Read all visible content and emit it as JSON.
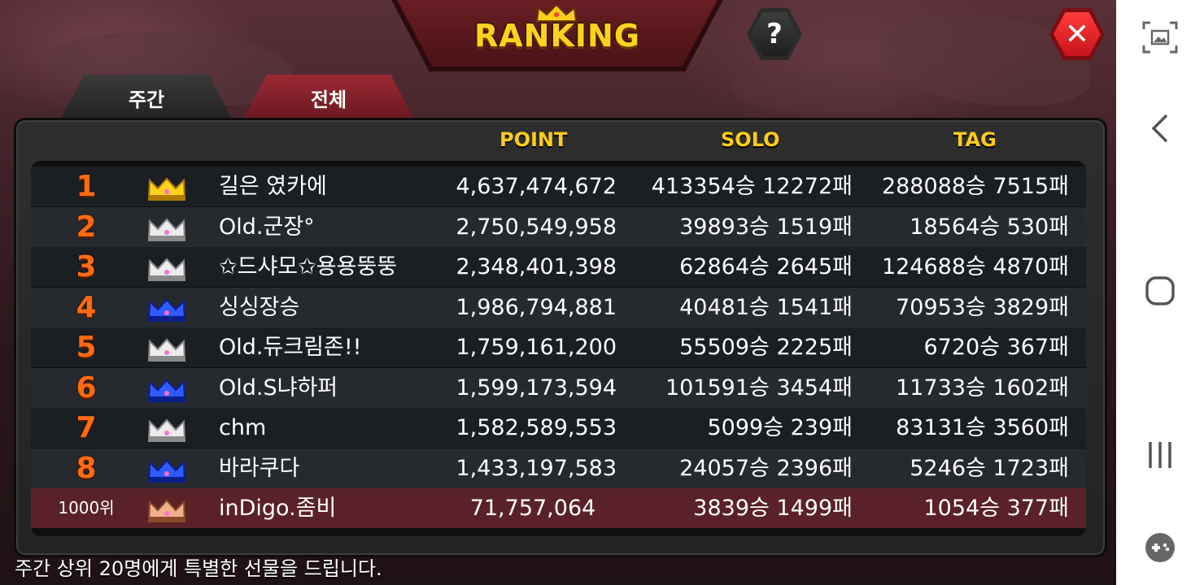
{
  "header": {
    "title": "RANKING",
    "help_label": "?",
    "close_label": "✕"
  },
  "tabs": [
    {
      "label": "주간",
      "active": true
    },
    {
      "label": "전체",
      "active": false
    }
  ],
  "columns": {
    "point": "POINT",
    "solo": "SOLO",
    "tag": "TAG"
  },
  "rows": [
    {
      "rank": "1",
      "crown": "gold",
      "name": "길은 였카에",
      "point": "4,637,474,672",
      "solo": "413354승 12272패",
      "tag": "288088승 7515패"
    },
    {
      "rank": "2",
      "crown": "silver",
      "name": "Old.군장°",
      "point": "2,750,549,958",
      "solo": "39893승 1519패",
      "tag": "18564승 530패"
    },
    {
      "rank": "3",
      "crown": "silver",
      "name": "✩드샤모✩용용뚱뚱",
      "point": "2,348,401,398",
      "solo": "62864승 2645패",
      "tag": "124688승 4870패"
    },
    {
      "rank": "4",
      "crown": "blue",
      "name": "싱싱장승",
      "point": "1,986,794,881",
      "solo": "40481승 1541패",
      "tag": "70953승 3829패"
    },
    {
      "rank": "5",
      "crown": "silver",
      "name": "Old.듀크림존!!",
      "point": "1,759,161,200",
      "solo": "55509승 2225패",
      "tag": "6720승 367패"
    },
    {
      "rank": "6",
      "crown": "blue",
      "name": "Old.S냐하퍼",
      "point": "1,599,173,594",
      "solo": "101591승 3454패",
      "tag": "11733승 1602패"
    },
    {
      "rank": "7",
      "crown": "silver",
      "name": "chm",
      "point": "1,582,589,553",
      "solo": "5099승 239패",
      "tag": "83131승 3560패"
    },
    {
      "rank": "8",
      "crown": "blue",
      "name": "바라쿠다",
      "point": "1,433,197,583",
      "solo": "24057승 2396패",
      "tag": "5246승 1723패"
    }
  ],
  "my_row": {
    "rank": "1000위",
    "crown": "bronze",
    "name": "inDigo.좀비",
    "point": "71,757,064",
    "solo": "3839승 1499패",
    "tag": "1054승 377패"
  },
  "footer_note": "주간 상위 20명에게 특별한 선물을 드립니다.",
  "colors": {
    "gold": "#ffd21f",
    "silver": "#e6e6e6",
    "blue": "#2248ff",
    "bronze": "#e8a07a",
    "rank_orange": "#ff6a12",
    "header_yellow": "#ffcc1a"
  },
  "navbar": {
    "icons": [
      "screenshot-icon",
      "back-icon",
      "home-icon",
      "recents-icon",
      "game-tools-icon"
    ]
  }
}
